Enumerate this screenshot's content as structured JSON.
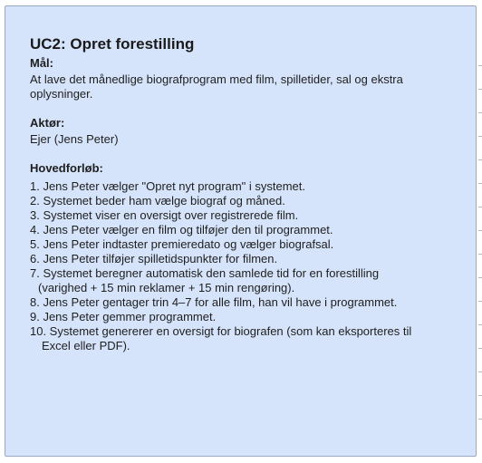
{
  "card": {
    "title": "UC2: Opret forestilling",
    "goal_label": "Mål:",
    "goal_text": "At lave det månedlige biografprogram med film, spilletider, sal og ekstra oplysninger.",
    "actor_label": "Aktør:",
    "actor_text": "Ejer (Jens Peter)",
    "main_flow_label": "Hovedforløb:",
    "steps": [
      "1. Jens Peter vælger \"Opret nyt program\" i systemet.",
      "2. Systemet beder ham vælge biograf og måned.",
      "3. Systemet viser en oversigt over registrerede film.",
      "4. Jens Peter vælger en film og tilføjer den til programmet.",
      "5. Jens Peter indtaster premieredato og vælger biografsal.",
      "6. Jens Peter tilføjer spilletidspunkter for filmen.",
      "7. Systemet beregner automatisk den samlede tid for en forestilling (varighed + 15 min reklamer + 15 min rengøring).",
      "8. Jens Peter gentager trin 4–7 for alle film, han vil have i programmet.",
      "9. Jens Peter gemmer programmet.",
      "10. Systemet genererer en oversigt for biografen (som kan eksporteres til Excel eller PDF)."
    ]
  },
  "colors": {
    "card_background": "#d6e4fb",
    "card_border": "#9aa9bd",
    "text": "#1e1e1e"
  }
}
